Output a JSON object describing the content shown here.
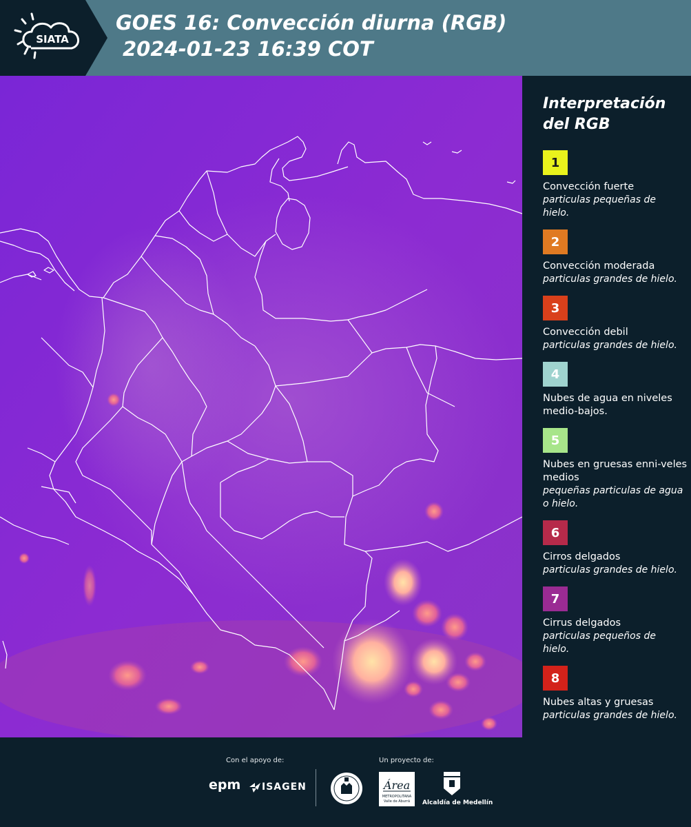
{
  "header": {
    "logo_text": "SIATA",
    "title_line1": "GOES 16: Convección diurna (RGB)",
    "title_line2": "2024-01-23 16:39 COT"
  },
  "colors": {
    "header_bg": "#4e7988",
    "panel_bg": "#0c1f2b",
    "map_base": "#8a2bd8",
    "boundary": "#ffffff"
  },
  "legend": {
    "title_line1": "Interpretación",
    "title_line2": "del RGB",
    "items": [
      {
        "number": "1",
        "color": "#e9f21c",
        "dark_text": true,
        "label": "Convección fuerte",
        "sub": "particulas pequeñas de hielo."
      },
      {
        "number": "2",
        "color": "#e07a22",
        "dark_text": false,
        "label": "Convección moderada",
        "sub": "particulas grandes de hielo."
      },
      {
        "number": "3",
        "color": "#d9401b",
        "dark_text": false,
        "label": "Convección debil",
        "sub": "particulas grandes de hielo."
      },
      {
        "number": "4",
        "color": "#9fd3cf",
        "dark_text": false,
        "label": "Nubes de agua en niveles medio-bajos.",
        "sub": ""
      },
      {
        "number": "5",
        "color": "#a7e58a",
        "dark_text": false,
        "label": "Nubes en gruesas enni-veles medios",
        "sub": "pequeñas particulas de agua o hielo."
      },
      {
        "number": "6",
        "color": "#b62a4a",
        "dark_text": false,
        "label": "Cirros delgados",
        "sub": "particulas grandes de hielo."
      },
      {
        "number": "7",
        "color": "#9a2b93",
        "dark_text": false,
        "label": "Cirrus delgados",
        "sub": "particulas pequeños de hielo."
      },
      {
        "number": "8",
        "color": "#d3221a",
        "dark_text": false,
        "label": "Nubes altas y gruesas",
        "sub": "particulas grandes de hielo."
      }
    ]
  },
  "footer": {
    "support_label": "Con el apoyo de:",
    "project_label": "Un proyecto de:",
    "sponsor_epm": "epm",
    "sponsor_isagen": "ISAGEN",
    "area_text": "Área",
    "area_sub1": "METROPOLITANA",
    "area_sub2": "Valle de Aburrá",
    "alcaldia": "Alcaldía de Medellín"
  }
}
